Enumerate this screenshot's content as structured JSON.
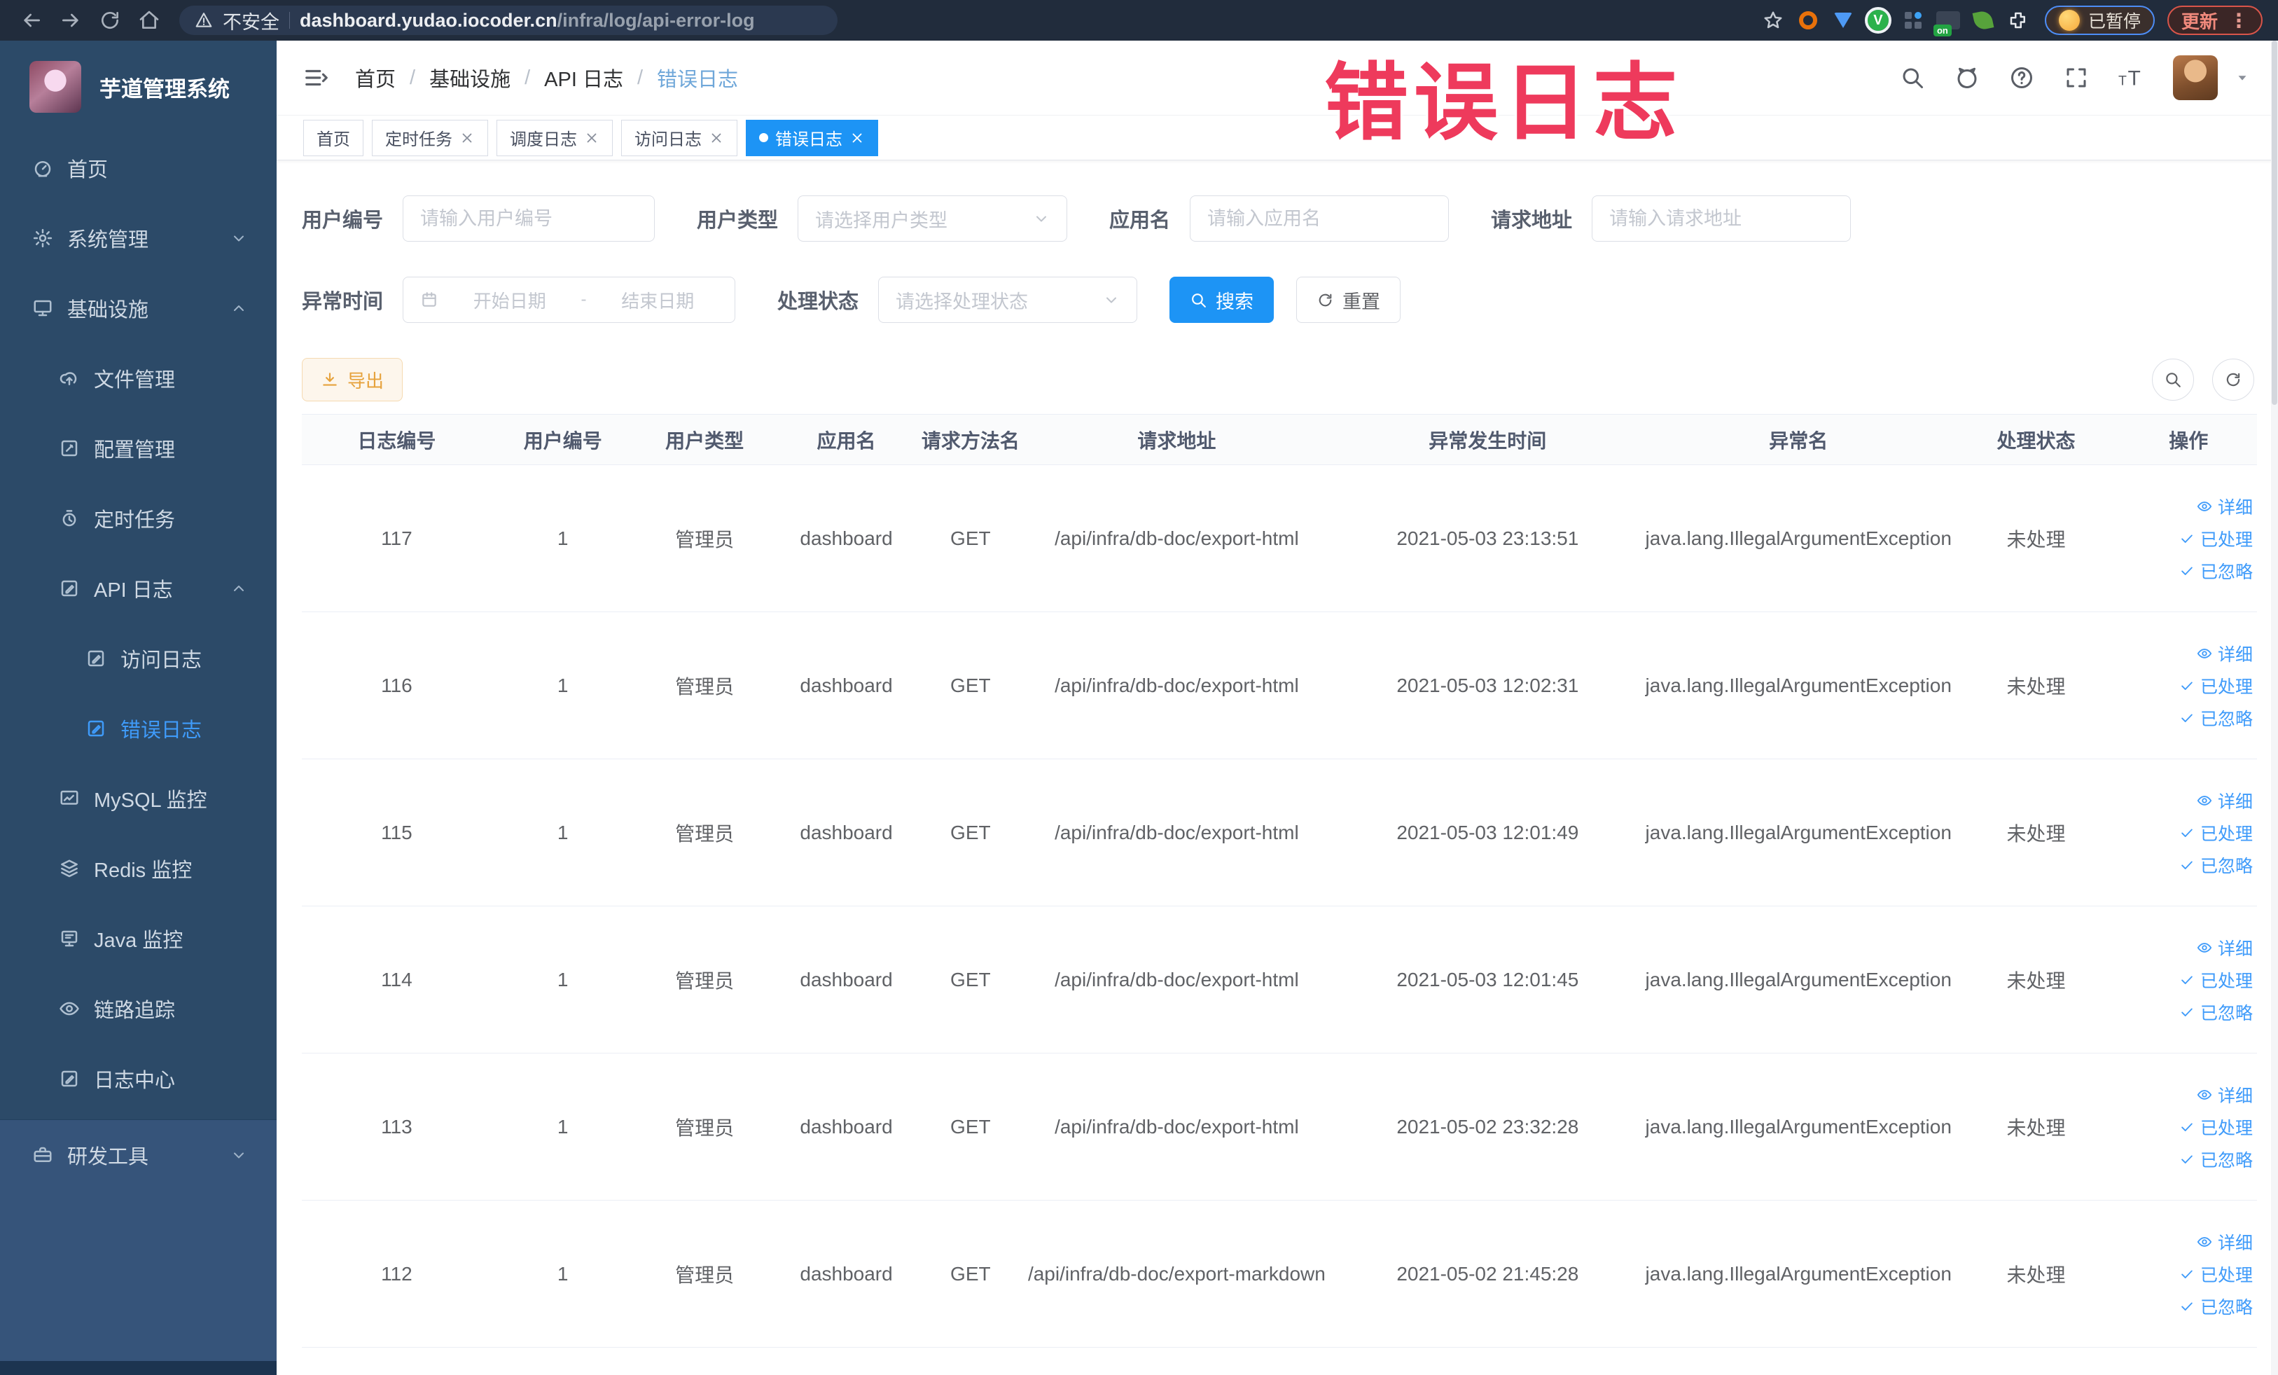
{
  "colors": {
    "accent": "#409EFF",
    "active_tab": "#1d94f5",
    "warning": "#e6a23c",
    "annotation_red": "#ee3a5c",
    "sidebar_bg": "#2c4a68"
  },
  "annotation": {
    "text": "错误日志"
  },
  "browser": {
    "insecure_label": "不安全",
    "url_host": "dashboard.yudao.iocoder.cn",
    "url_path": "/infra/log/api-error-log",
    "ext_on_label": "on",
    "paused_label": "已暂停",
    "update_label": "更新"
  },
  "sidebar": {
    "title": "芋道管理系统",
    "items": [
      {
        "label": "首页",
        "icon": "gauge",
        "level": 1,
        "chevron": "",
        "active": false
      },
      {
        "label": "系统管理",
        "icon": "gear",
        "level": 1,
        "chevron": "down",
        "active": false
      },
      {
        "label": "基础设施",
        "icon": "monitor",
        "level": 1,
        "chevron": "up",
        "active": false
      },
      {
        "label": "文件管理",
        "icon": "upload-cloud",
        "level": 2,
        "chevron": "",
        "active": false
      },
      {
        "label": "配置管理",
        "icon": "edit-square",
        "level": 2,
        "chevron": "",
        "active": false
      },
      {
        "label": "定时任务",
        "icon": "timer",
        "level": 2,
        "chevron": "",
        "active": false
      },
      {
        "label": "API 日志",
        "icon": "doc-edit",
        "level": 2,
        "chevron": "up",
        "active": false
      },
      {
        "label": "访问日志",
        "icon": "doc-edit",
        "level": 3,
        "chevron": "",
        "active": false
      },
      {
        "label": "错误日志",
        "icon": "doc-edit",
        "level": 3,
        "chevron": "",
        "active": true
      },
      {
        "label": "MySQL 监控",
        "icon": "chart",
        "level": 2,
        "chevron": "",
        "active": false
      },
      {
        "label": "Redis 监控",
        "icon": "layers",
        "level": 2,
        "chevron": "",
        "active": false
      },
      {
        "label": "Java 监控",
        "icon": "java",
        "level": 2,
        "chevron": "",
        "active": false
      },
      {
        "label": "链路追踪",
        "icon": "eye",
        "level": 2,
        "chevron": "",
        "active": false
      },
      {
        "label": "日志中心",
        "icon": "doc-edit",
        "level": 2,
        "chevron": "",
        "active": false
      }
    ],
    "tools_item": {
      "label": "研发工具",
      "icon": "toolbox",
      "chevron": "down"
    }
  },
  "header": {
    "breadcrumbs": [
      {
        "label": "首页",
        "current": false
      },
      {
        "label": "基础设施",
        "current": false
      },
      {
        "label": "API 日志",
        "current": false
      },
      {
        "label": "错误日志",
        "current": true
      }
    ]
  },
  "tabs": [
    {
      "label": "首页",
      "closable": false,
      "active": false
    },
    {
      "label": "定时任务",
      "closable": true,
      "active": false
    },
    {
      "label": "调度日志",
      "closable": true,
      "active": false
    },
    {
      "label": "访问日志",
      "closable": true,
      "active": false
    },
    {
      "label": "错误日志",
      "closable": true,
      "active": true
    }
  ],
  "filters": {
    "user_id_label": "用户编号",
    "user_id_placeholder": "请输入用户编号",
    "user_type_label": "用户类型",
    "user_type_placeholder": "请选择用户类型",
    "app_name_label": "应用名",
    "app_name_placeholder": "请输入应用名",
    "request_url_label": "请求地址",
    "request_url_placeholder": "请输入请求地址",
    "time_label": "异常时间",
    "time_start_placeholder": "开始日期",
    "time_separator": "-",
    "time_end_placeholder": "结束日期",
    "status_label": "处理状态",
    "status_placeholder": "请选择处理状态",
    "search_label": "搜索",
    "reset_label": "重置"
  },
  "toolbar": {
    "export_label": "导出"
  },
  "table": {
    "columns": [
      "日志编号",
      "用户编号",
      "用户类型",
      "应用名",
      "请求方法名",
      "请求地址",
      "异常发生时间",
      "异常名",
      "处理状态",
      "操作"
    ],
    "action_labels": [
      "详细",
      "已处理",
      "已忽略"
    ],
    "rows": [
      {
        "id": "117",
        "user_id": "1",
        "user_type": "管理员",
        "app": "dashboard",
        "method": "GET",
        "url": "/api/infra/db-doc/export-html",
        "time": "2021-05-03 23:13:51",
        "exception": "java.lang.IllegalArgumentException",
        "status": "未处理"
      },
      {
        "id": "116",
        "user_id": "1",
        "user_type": "管理员",
        "app": "dashboard",
        "method": "GET",
        "url": "/api/infra/db-doc/export-html",
        "time": "2021-05-03 12:02:31",
        "exception": "java.lang.IllegalArgumentException",
        "status": "未处理"
      },
      {
        "id": "115",
        "user_id": "1",
        "user_type": "管理员",
        "app": "dashboard",
        "method": "GET",
        "url": "/api/infra/db-doc/export-html",
        "time": "2021-05-03 12:01:49",
        "exception": "java.lang.IllegalArgumentException",
        "status": "未处理"
      },
      {
        "id": "114",
        "user_id": "1",
        "user_type": "管理员",
        "app": "dashboard",
        "method": "GET",
        "url": "/api/infra/db-doc/export-html",
        "time": "2021-05-03 12:01:45",
        "exception": "java.lang.IllegalArgumentException",
        "status": "未处理"
      },
      {
        "id": "113",
        "user_id": "1",
        "user_type": "管理员",
        "app": "dashboard",
        "method": "GET",
        "url": "/api/infra/db-doc/export-html",
        "time": "2021-05-02 23:32:28",
        "exception": "java.lang.IllegalArgumentException",
        "status": "未处理"
      },
      {
        "id": "112",
        "user_id": "1",
        "user_type": "管理员",
        "app": "dashboard",
        "method": "GET",
        "url": "/api/infra/db-doc/export-markdown",
        "time": "2021-05-02 21:45:28",
        "exception": "java.lang.IllegalArgumentException",
        "status": "未处理"
      }
    ]
  }
}
